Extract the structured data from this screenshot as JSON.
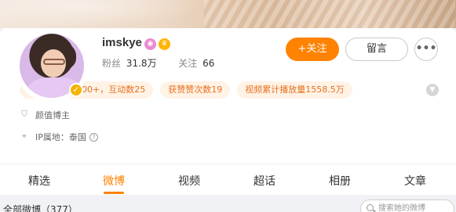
{
  "profile": {
    "username": "imskye",
    "fans_label": "粉丝",
    "fans_value": "31.8万",
    "following_label": "关注",
    "following_value": "66"
  },
  "actions": {
    "follow_label": "+关注",
    "message_label": "留言",
    "more_label": "•••"
  },
  "tags": [
    "昨日阅读数1000+，互动数25",
    "获赞赞次数19",
    "视频累计播放量1558.5万"
  ],
  "info": {
    "title_label": "颜值博主",
    "ip_label": "IP属地：泰国"
  },
  "tabs": [
    "精选",
    "微博",
    "视频",
    "超话",
    "相册",
    "文章"
  ],
  "active_tab": "微博",
  "feed": {
    "all_posts_label": "全部微博（377）",
    "search_placeholder": "搜索她的微博"
  },
  "colors": {
    "accent": "#ff8200",
    "tag_bg": "#fff3e6",
    "tag_text": "#e86f1f"
  },
  "icons": [
    "shield-icon",
    "location-icon",
    "help-icon",
    "chevron-down-icon",
    "search-icon",
    "crown-icon",
    "verified-icon"
  ]
}
